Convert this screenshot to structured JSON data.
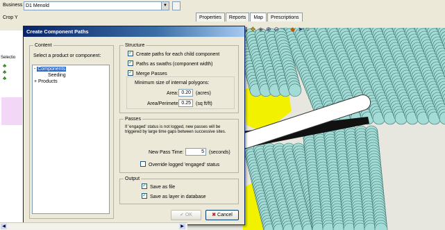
{
  "main": {
    "business_label": "Business",
    "business_value": "D1 Menold",
    "crop_label": "Crop Y",
    "tabs": [
      "Properties",
      "Reports",
      "Map",
      "Prescriptions"
    ],
    "active_tab": "Map",
    "left_labels": [
      "Selectio"
    ]
  },
  "dialog": {
    "title": "Create Component Paths",
    "content": {
      "group_label": "Content",
      "instruction": "Select a product or component:",
      "tree": [
        {
          "label": "Components",
          "expander": "-",
          "selected": true
        },
        {
          "label": "Seeding",
          "expander": "",
          "selected": false
        },
        {
          "label": "Products",
          "expander": "+",
          "selected": false
        }
      ]
    },
    "structure": {
      "group_label": "Structure",
      "create_paths": "Create paths for each child component",
      "paths_as_swaths": "Paths as swaths (component width)",
      "merge_passes": "Merge Passes",
      "min_size_label": "Minimum size of internal polygons:",
      "area_label": "Area:",
      "area_value": "0.20",
      "area_unit": "(acres)",
      "area_perimeter_label": "Area/Perimeter:",
      "area_perimeter_value": "0.25",
      "area_perimeter_unit": "(sq ft/ft)"
    },
    "passes": {
      "group_label": "Passes",
      "description": "If 'engaged' status is not logged, new passes will be triggered by large time gaps between successive sites.",
      "new_pass_label": "New Pass Time:",
      "new_pass_value": "5",
      "new_pass_unit": "(seconds)",
      "override_label": "Override logged 'engaged' status"
    },
    "output": {
      "group_label": "Output",
      "save_as_file": "Save as file",
      "save_as_layer": "Save as layer in database"
    },
    "ok_label": "OK",
    "cancel_label": "Cancel"
  },
  "colors": {
    "swath_fill": "#a3dcd6",
    "swath_stroke": "#3d6f6a",
    "field_yellow": "#f2f200",
    "title_bar": "#0a246a"
  }
}
